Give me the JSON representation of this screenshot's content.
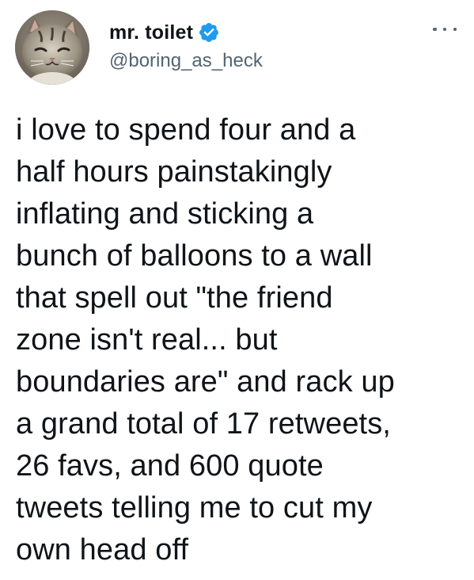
{
  "user": {
    "display_name": "mr. toilet",
    "handle": "@boring_as_heck",
    "verified": true,
    "verified_color": "#1d9bf0"
  },
  "icons": {
    "avatar": "cat-avatar-icon",
    "verified": "verified-badge-icon",
    "more": "more-options-icon"
  },
  "tweet": {
    "lines": [
      "i love to spend four and a",
      "half hours painstakingly",
      "inflating and sticking a",
      "bunch of balloons to a wall",
      "that spell out \"the friend",
      "zone isn't real... but",
      "boundaries are\" and rack up",
      "a grand total of 17 retweets,",
      "26 favs, and 600 quote",
      "tweets telling me to cut my",
      "own head off"
    ]
  }
}
